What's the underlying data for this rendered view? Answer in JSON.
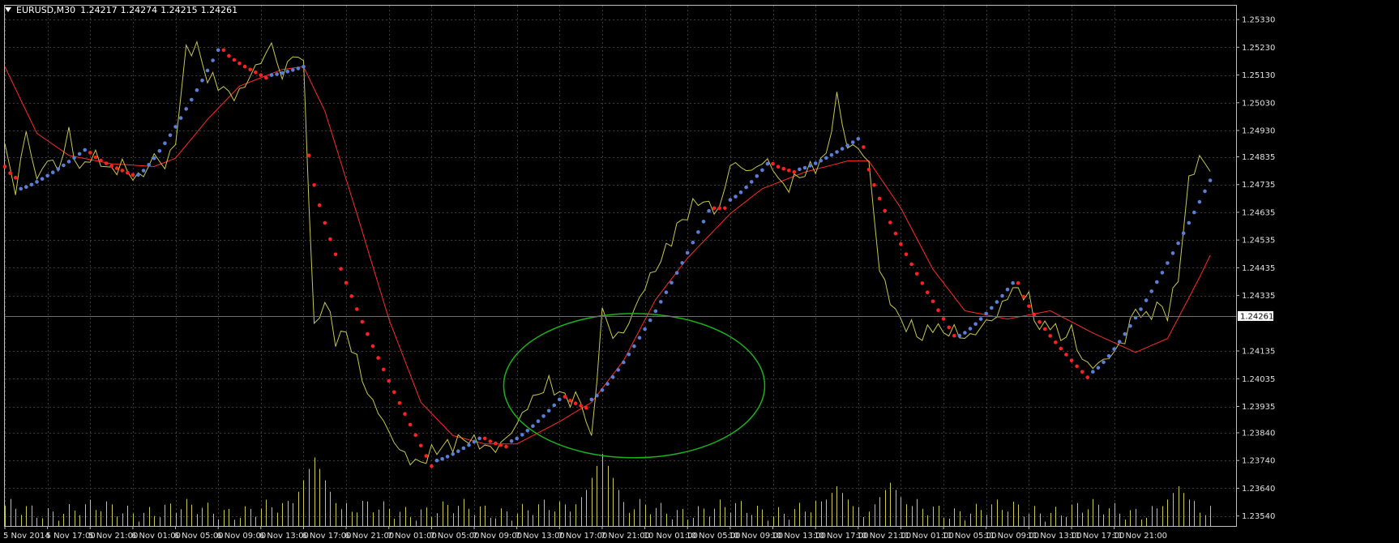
{
  "header": {
    "symbol": "EURUSD,M30",
    "open": "1.24217",
    "high": "1.24274",
    "low": "1.24215",
    "close": "1.24261"
  },
  "colors": {
    "background": "#000000",
    "grid": "#3a3a3a",
    "price_line": "#c8c84a",
    "moving_average": "#ff2a2a",
    "sar_up": "#5a7fd8",
    "sar_down": "#ff2020",
    "volume": "#c8c84a",
    "annotation_ellipse": "#19b419",
    "price_tag_bg": "#ffffff",
    "price_tag_text": "#000000"
  },
  "chart_data": {
    "type": "line",
    "ylim": [
      1.23504,
      1.2538
    ],
    "y_ticks": [
      "1.25330",
      "1.25230",
      "1.25130",
      "1.25030",
      "1.24930",
      "1.24835",
      "1.24735",
      "1.24635",
      "1.24535",
      "1.24435",
      "1.24335",
      "1.24135",
      "1.24035",
      "1.23935",
      "1.23840",
      "1.23740",
      "1.23640",
      "1.23540"
    ],
    "current_price": "1.24261",
    "x_labels": [
      "5 Nov 2014",
      "5 Nov 17:00",
      "5 Nov 21:00",
      "6 Nov 01:00",
      "6 Nov 05:00",
      "6 Nov 09:00",
      "6 Nov 13:00",
      "6 Nov 17:00",
      "6 Nov 21:00",
      "7 Nov 01:00",
      "7 Nov 05:00",
      "7 Nov 09:00",
      "7 Nov 13:00",
      "7 Nov 17:00",
      "7 Nov 21:00",
      "10 Nov 01:00",
      "10 Nov 05:00",
      "10 Nov 09:00",
      "10 Nov 13:00",
      "10 Nov 17:00",
      "10 Nov 21:00",
      "11 Nov 01:00",
      "11 Nov 05:00",
      "11 Nov 09:00",
      "11 Nov 13:00",
      "11 Nov 17:00",
      "11 Nov 21:00"
    ],
    "price_series": {
      "points_per_label": 8,
      "anchors": [
        [
          0,
          1.2487
        ],
        [
          2,
          1.2471
        ],
        [
          4,
          1.2493
        ],
        [
          6,
          1.2475
        ],
        [
          8,
          1.2483
        ],
        [
          10,
          1.2479
        ],
        [
          12,
          1.2492
        ],
        [
          14,
          1.2478
        ],
        [
          16,
          1.2484
        ],
        [
          18,
          1.2482
        ],
        [
          20,
          1.2478
        ],
        [
          22,
          1.2481
        ],
        [
          24,
          1.2476
        ],
        [
          26,
          1.2477
        ],
        [
          28,
          1.2484
        ],
        [
          30,
          1.248
        ],
        [
          32,
          1.2489
        ],
        [
          34,
          1.2522
        ],
        [
          36,
          1.2523
        ],
        [
          38,
          1.2512
        ],
        [
          40,
          1.251
        ],
        [
          42,
          1.2506
        ],
        [
          44,
          1.2506
        ],
        [
          46,
          1.2513
        ],
        [
          48,
          1.2518
        ],
        [
          50,
          1.2524
        ],
        [
          52,
          1.2512
        ],
        [
          54,
          1.2521
        ],
        [
          56,
          1.2517
        ],
        [
          58,
          1.2421
        ],
        [
          60,
          1.2432
        ],
        [
          62,
          1.2418
        ],
        [
          64,
          1.242
        ],
        [
          66,
          1.241
        ],
        [
          68,
          1.2398
        ],
        [
          70,
          1.2392
        ],
        [
          72,
          1.2384
        ],
        [
          74,
          1.2378
        ],
        [
          76,
          1.2374
        ],
        [
          78,
          1.2373
        ],
        [
          80,
          1.2377
        ],
        [
          82,
          1.2379
        ],
        [
          84,
          1.238
        ],
        [
          86,
          1.2382
        ],
        [
          88,
          1.2381
        ],
        [
          90,
          1.2379
        ],
        [
          92,
          1.2378
        ],
        [
          94,
          1.2382
        ],
        [
          96,
          1.2387
        ],
        [
          98,
          1.2394
        ],
        [
          100,
          1.2398
        ],
        [
          102,
          1.2402
        ],
        [
          104,
          1.2398
        ],
        [
          106,
          1.2396
        ],
        [
          108,
          1.2396
        ],
        [
          110,
          1.2381
        ],
        [
          112,
          1.2428
        ],
        [
          114,
          1.2419
        ],
        [
          116,
          1.242
        ],
        [
          118,
          1.2428
        ],
        [
          120,
          1.2437
        ],
        [
          122,
          1.2443
        ],
        [
          124,
          1.245
        ],
        [
          126,
          1.2458
        ],
        [
          128,
          1.2463
        ],
        [
          130,
          1.2468
        ],
        [
          132,
          1.2466
        ],
        [
          134,
          1.2464
        ],
        [
          136,
          1.2481
        ],
        [
          138,
          1.248
        ],
        [
          140,
          1.2478
        ],
        [
          142,
          1.2482
        ],
        [
          144,
          1.248
        ],
        [
          146,
          1.2472
        ],
        [
          148,
          1.2475
        ],
        [
          150,
          1.2478
        ],
        [
          152,
          1.248
        ],
        [
          154,
          1.2484
        ],
        [
          156,
          1.2505
        ],
        [
          158,
          1.2487
        ],
        [
          160,
          1.2487
        ],
        [
          162,
          1.2481
        ],
        [
          164,
          1.2443
        ],
        [
          166,
          1.2432
        ],
        [
          168,
          1.2424
        ],
        [
          170,
          1.2422
        ],
        [
          172,
          1.2418
        ],
        [
          174,
          1.2423
        ],
        [
          176,
          1.242
        ],
        [
          178,
          1.2421
        ],
        [
          180,
          1.2418
        ],
        [
          182,
          1.242
        ],
        [
          184,
          1.2424
        ],
        [
          186,
          1.2426
        ],
        [
          188,
          1.2434
        ],
        [
          190,
          1.2436
        ],
        [
          192,
          1.2432
        ],
        [
          194,
          1.2421
        ],
        [
          196,
          1.2424
        ],
        [
          198,
          1.2418
        ],
        [
          200,
          1.2421
        ],
        [
          202,
          1.241
        ],
        [
          204,
          1.2408
        ],
        [
          206,
          1.241
        ],
        [
          208,
          1.2413
        ],
        [
          210,
          1.2418
        ],
        [
          212,
          1.2429
        ],
        [
          214,
          1.2425
        ],
        [
          216,
          1.243
        ],
        [
          218,
          1.2427
        ],
        [
          220,
          1.244
        ],
        [
          222,
          1.2475
        ],
        [
          224,
          1.2483
        ],
        [
          226,
          1.2479
        ]
      ]
    },
    "moving_average": {
      "anchors": [
        [
          0,
          1.2516
        ],
        [
          6,
          1.2492
        ],
        [
          12,
          1.2484
        ],
        [
          20,
          1.2481
        ],
        [
          28,
          1.248
        ],
        [
          32,
          1.2483
        ],
        [
          38,
          1.2497
        ],
        [
          44,
          1.2509
        ],
        [
          52,
          1.2515
        ],
        [
          56,
          1.2516
        ],
        [
          60,
          1.25
        ],
        [
          66,
          1.2463
        ],
        [
          72,
          1.2425
        ],
        [
          78,
          1.2395
        ],
        [
          84,
          1.2383
        ],
        [
          90,
          1.238
        ],
        [
          96,
          1.238
        ],
        [
          104,
          1.2388
        ],
        [
          110,
          1.2395
        ],
        [
          116,
          1.241
        ],
        [
          122,
          1.2432
        ],
        [
          128,
          1.2447
        ],
        [
          136,
          1.2463
        ],
        [
          142,
          1.2472
        ],
        [
          150,
          1.2478
        ],
        [
          158,
          1.2482
        ],
        [
          162,
          1.2482
        ],
        [
          168,
          1.2465
        ],
        [
          174,
          1.2443
        ],
        [
          180,
          1.2428
        ],
        [
          188,
          1.2425
        ],
        [
          196,
          1.2428
        ],
        [
          204,
          1.242
        ],
        [
          212,
          1.2413
        ],
        [
          218,
          1.2418
        ],
        [
          224,
          1.244
        ],
        [
          226,
          1.2448
        ]
      ]
    },
    "parabolic_sar": [
      {
        "from": 0,
        "to": 2,
        "dir": "down",
        "start": 1.248,
        "end": 1.2476
      },
      {
        "from": 3,
        "to": 15,
        "dir": "up",
        "start": 1.2472,
        "end": 1.2486
      },
      {
        "from": 16,
        "to": 24,
        "dir": "down",
        "start": 1.2485,
        "end": 1.2477
      },
      {
        "from": 25,
        "to": 40,
        "dir": "up",
        "start": 1.2477,
        "end": 1.2522
      },
      {
        "from": 41,
        "to": 49,
        "dir": "down",
        "start": 1.2522,
        "end": 1.2512
      },
      {
        "from": 50,
        "to": 56,
        "dir": "up",
        "start": 1.2513,
        "end": 1.2516
      },
      {
        "from": 57,
        "to": 80,
        "dir": "down",
        "start": 1.2484,
        "end": 1.2372
      },
      {
        "from": 81,
        "to": 89,
        "dir": "up",
        "start": 1.2374,
        "end": 1.2382
      },
      {
        "from": 90,
        "to": 94,
        "dir": "down",
        "start": 1.2382,
        "end": 1.2379
      },
      {
        "from": 95,
        "to": 104,
        "dir": "up",
        "start": 1.2381,
        "end": 1.2396
      },
      {
        "from": 105,
        "to": 109,
        "dir": "down",
        "start": 1.2397,
        "end": 1.2393
      },
      {
        "from": 110,
        "to": 132,
        "dir": "up",
        "start": 1.2396,
        "end": 1.2464
      },
      {
        "from": 133,
        "to": 135,
        "dir": "down",
        "start": 1.2465,
        "end": 1.2465
      },
      {
        "from": 136,
        "to": 143,
        "dir": "up",
        "start": 1.2468,
        "end": 1.2481
      },
      {
        "from": 144,
        "to": 148,
        "dir": "down",
        "start": 1.2481,
        "end": 1.2478
      },
      {
        "from": 149,
        "to": 160,
        "dir": "up",
        "start": 1.2479,
        "end": 1.249
      },
      {
        "from": 161,
        "to": 178,
        "dir": "down",
        "start": 1.2487,
        "end": 1.2419
      },
      {
        "from": 179,
        "to": 189,
        "dir": "up",
        "start": 1.2419,
        "end": 1.2438
      },
      {
        "from": 190,
        "to": 203,
        "dir": "down",
        "start": 1.2438,
        "end": 1.2404
      },
      {
        "from": 204,
        "to": 226,
        "dir": "up",
        "start": 1.2406,
        "end": 1.2475
      }
    ],
    "volume": {
      "max": 100,
      "peaks": [
        [
          58,
          95
        ],
        [
          112,
          100
        ],
        [
          110,
          60
        ],
        [
          156,
          55
        ],
        [
          166,
          60
        ],
        [
          220,
          55
        ]
      ],
      "base": 22
    },
    "annotation": {
      "shape": "ellipse",
      "center_index": 118,
      "center_price": 1.2401
    }
  }
}
